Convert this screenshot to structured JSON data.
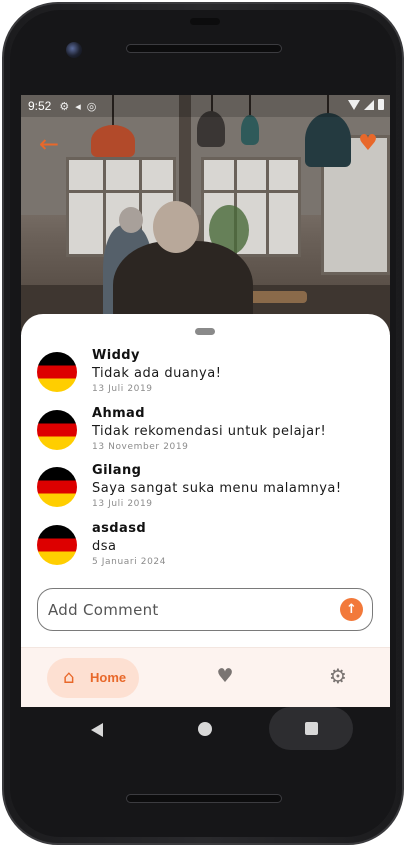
{
  "status_bar": {
    "time": "9:52",
    "icons": [
      "gear-icon",
      "flutter-icon",
      "at-icon"
    ]
  },
  "header": {
    "back_icon": "arrow-left-icon",
    "favorite_icon": "heart-icon",
    "accent_color": "#e8682a"
  },
  "comments": [
    {
      "name": "Widdy",
      "text": "Tidak ada duanya!",
      "date": "13 Juli 2019",
      "avatar": "germany-flag"
    },
    {
      "name": "Ahmad",
      "text": "Tidak rekomendasi untuk pelajar!",
      "date": "13 November 2019",
      "avatar": "germany-flag"
    },
    {
      "name": "Gilang",
      "text": "Saya sangat suka menu malamnya!",
      "date": "13 Juli 2019",
      "avatar": "germany-flag"
    },
    {
      "name": "asdasd",
      "text": "dsa",
      "date": "5 Januari 2024",
      "avatar": "germany-flag"
    }
  ],
  "comment_input": {
    "placeholder": "Add Comment",
    "value": "",
    "send_icon": "arrow-up-icon"
  },
  "bottom_nav": {
    "items": [
      {
        "label": "Home",
        "icon": "home-icon",
        "active": true
      },
      {
        "label": "",
        "icon": "heart-icon",
        "active": false
      },
      {
        "label": "",
        "icon": "gear-icon",
        "active": false
      }
    ],
    "active_bg": "#fde0d2",
    "bar_bg": "#fdf3ef"
  }
}
